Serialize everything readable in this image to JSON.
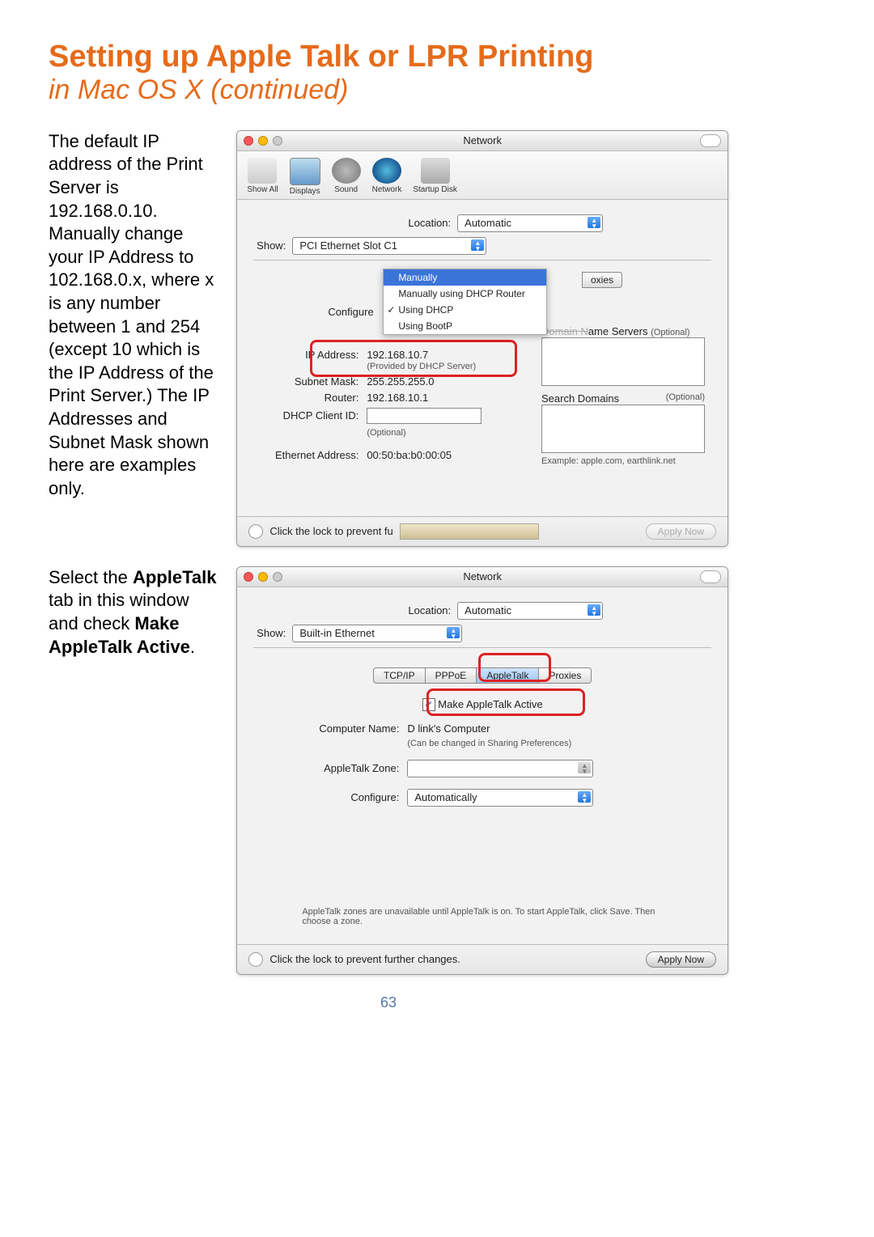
{
  "page": {
    "title": "Setting up Apple Talk or LPR Printing",
    "subtitle": "in Mac OS X (continued)",
    "number": "63"
  },
  "blurb1": "The default IP address of the Print Server is 192.168.0.10. Manually change your IP Address to 102.168.0.x, where x is any number between 1 and 254 (except 10 which is the IP Address of the Print Server.) The IP Addresses and Subnet Mask shown here are examples only.",
  "blurb2_pre": "Select the ",
  "blurb2_b1": "AppleTalk",
  "blurb2_mid": " tab in this window and check ",
  "blurb2_b2": "Make AppleTalk Active",
  "blurb2_post": ".",
  "win1": {
    "title": "Network",
    "toolbar": {
      "showall": "Show All",
      "displays": "Displays",
      "sound": "Sound",
      "network": "Network",
      "startup": "Startup Disk"
    },
    "location_label": "Location:",
    "location_value": "Automatic",
    "show_label": "Show:",
    "show_value": "PCI Ethernet Slot C1",
    "tab_partial": "oxies",
    "config_menu": {
      "manually": "Manually",
      "dhcp_router": "Manually using DHCP Router",
      "using_dhcp": "Using DHCP",
      "using_bootp": "Using BootP"
    },
    "configure_label": "Configure",
    "dns_label_partial": "ame Servers",
    "dns_domain_prefix": "Domain N",
    "optional": "(Optional)",
    "ip_label": "IP Address:",
    "ip_value": "192.168.10.7",
    "ip_note": "(Provided by DHCP Server)",
    "subnet_label": "Subnet Mask:",
    "subnet_value": "255.255.255.0",
    "router_label": "Router:",
    "router_value": "192.168.10.1",
    "search_domains": "Search Domains",
    "dhcp_client_label": "DHCP Client ID:",
    "dhcp_note": "(Optional)",
    "example": "Example: apple.com, earthlink.net",
    "eth_label": "Ethernet Address:",
    "eth_value": "00:50:ba:b0:00:05",
    "lock_text": "Click the lock to prevent fu",
    "apply": "Apply Now"
  },
  "win2": {
    "title": "Network",
    "location_label": "Location:",
    "location_value": "Automatic",
    "show_label": "Show:",
    "show_value": "Built-in Ethernet",
    "tabs": {
      "tcpip": "TCP/IP",
      "pppoe": "PPPoE",
      "appletalk": "AppleTalk",
      "proxies": "Proxies"
    },
    "make_active": "Make AppleTalk Active",
    "computer_name_label": "Computer Name:",
    "computer_name_value": "D link's Computer",
    "computer_name_note": "(Can be changed in Sharing Preferences)",
    "zone_label": "AppleTalk Zone:",
    "configure_label": "Configure:",
    "configure_value": "Automatically",
    "zones_note": "AppleTalk zones are unavailable until AppleTalk is on. To start AppleTalk, click Save. Then choose a zone.",
    "lock_text": "Click the lock to prevent further changes.",
    "apply": "Apply Now"
  }
}
